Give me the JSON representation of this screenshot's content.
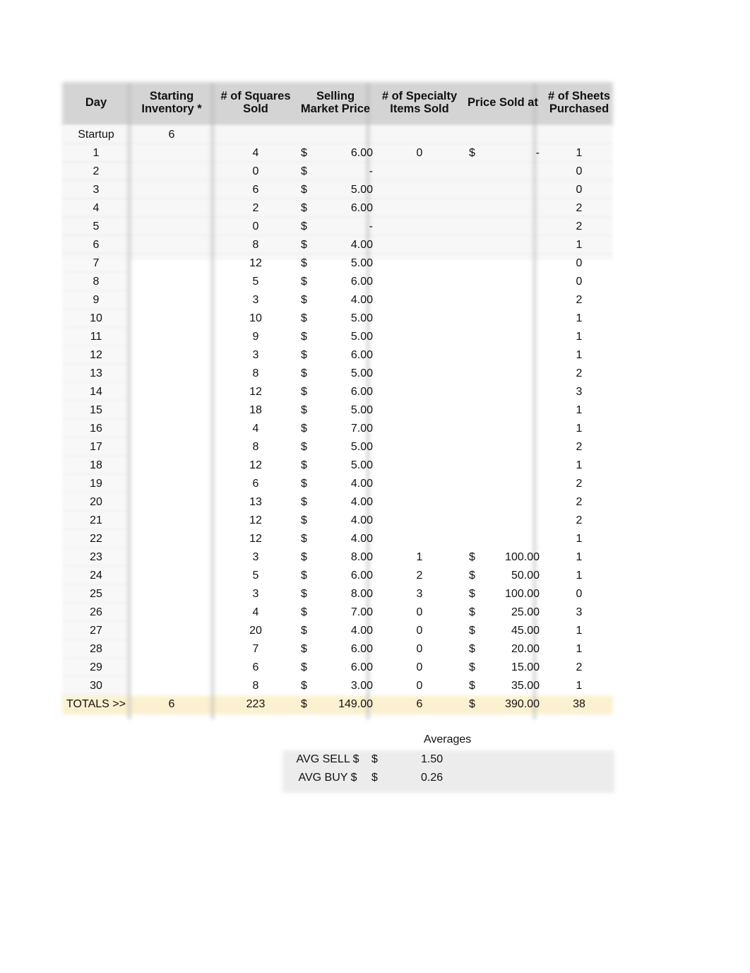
{
  "headers": {
    "day": "Day",
    "starting_inventory": [
      "Starting",
      "Inventory *"
    ],
    "squares_sold": [
      "# of Squares",
      "Sold"
    ],
    "selling_price": [
      "Selling",
      "Market  Price"
    ],
    "specialty_items": [
      "# of Specialty",
      "Items Sold"
    ],
    "price_sold_at": "Price Sold at",
    "sheets_purchased": [
      "# of Sheets",
      "Purchased"
    ]
  },
  "startup": {
    "label": "Startup",
    "inventory": "6"
  },
  "rows": [
    {
      "day": "1",
      "sq": "4",
      "cur": "$",
      "price": "6.00",
      "spec": "0",
      "cur2": "$",
      "sold": "-",
      "sheets": "1"
    },
    {
      "day": "2",
      "sq": "0",
      "cur": "$",
      "price": "-",
      "spec": "",
      "cur2": "",
      "sold": "",
      "sheets": "0"
    },
    {
      "day": "3",
      "sq": "6",
      "cur": "$",
      "price": "5.00",
      "spec": "",
      "cur2": "",
      "sold": "",
      "sheets": "0"
    },
    {
      "day": "4",
      "sq": "2",
      "cur": "$",
      "price": "6.00",
      "spec": "",
      "cur2": "",
      "sold": "",
      "sheets": "2"
    },
    {
      "day": "5",
      "sq": "0",
      "cur": "$",
      "price": "-",
      "spec": "",
      "cur2": "",
      "sold": "",
      "sheets": "2"
    },
    {
      "day": "6",
      "sq": "8",
      "cur": "$",
      "price": "4.00",
      "spec": "",
      "cur2": "",
      "sold": "",
      "sheets": "1"
    },
    {
      "day": "7",
      "sq": "12",
      "cur": "$",
      "price": "5.00",
      "spec": "",
      "cur2": "",
      "sold": "",
      "sheets": "0"
    },
    {
      "day": "8",
      "sq": "5",
      "cur": "$",
      "price": "6.00",
      "spec": "",
      "cur2": "",
      "sold": "",
      "sheets": "0"
    },
    {
      "day": "9",
      "sq": "3",
      "cur": "$",
      "price": "4.00",
      "spec": "",
      "cur2": "",
      "sold": "",
      "sheets": "2"
    },
    {
      "day": "10",
      "sq": "10",
      "cur": "$",
      "price": "5.00",
      "spec": "",
      "cur2": "",
      "sold": "",
      "sheets": "1"
    },
    {
      "day": "11",
      "sq": "9",
      "cur": "$",
      "price": "5.00",
      "spec": "",
      "cur2": "",
      "sold": "",
      "sheets": "1"
    },
    {
      "day": "12",
      "sq": "3",
      "cur": "$",
      "price": "6.00",
      "spec": "",
      "cur2": "",
      "sold": "",
      "sheets": "1"
    },
    {
      "day": "13",
      "sq": "8",
      "cur": "$",
      "price": "5.00",
      "spec": "",
      "cur2": "",
      "sold": "",
      "sheets": "2"
    },
    {
      "day": "14",
      "sq": "12",
      "cur": "$",
      "price": "6.00",
      "spec": "",
      "cur2": "",
      "sold": "",
      "sheets": "3"
    },
    {
      "day": "15",
      "sq": "18",
      "cur": "$",
      "price": "5.00",
      "spec": "",
      "cur2": "",
      "sold": "",
      "sheets": "1"
    },
    {
      "day": "16",
      "sq": "4",
      "cur": "$",
      "price": "7.00",
      "spec": "",
      "cur2": "",
      "sold": "",
      "sheets": "1"
    },
    {
      "day": "17",
      "sq": "8",
      "cur": "$",
      "price": "5.00",
      "spec": "",
      "cur2": "",
      "sold": "",
      "sheets": "2"
    },
    {
      "day": "18",
      "sq": "12",
      "cur": "$",
      "price": "5.00",
      "spec": "",
      "cur2": "",
      "sold": "",
      "sheets": "1"
    },
    {
      "day": "19",
      "sq": "6",
      "cur": "$",
      "price": "4.00",
      "spec": "",
      "cur2": "",
      "sold": "",
      "sheets": "2"
    },
    {
      "day": "20",
      "sq": "13",
      "cur": "$",
      "price": "4.00",
      "spec": "",
      "cur2": "",
      "sold": "",
      "sheets": "2"
    },
    {
      "day": "21",
      "sq": "12",
      "cur": "$",
      "price": "4.00",
      "spec": "",
      "cur2": "",
      "sold": "",
      "sheets": "2"
    },
    {
      "day": "22",
      "sq": "12",
      "cur": "$",
      "price": "4.00",
      "spec": "",
      "cur2": "",
      "sold": "",
      "sheets": "1"
    },
    {
      "day": "23",
      "sq": "3",
      "cur": "$",
      "price": "8.00",
      "spec": "1",
      "cur2": "$",
      "sold": "100.00",
      "sheets": "1"
    },
    {
      "day": "24",
      "sq": "5",
      "cur": "$",
      "price": "6.00",
      "spec": "2",
      "cur2": "$",
      "sold": "50.00",
      "sheets": "1"
    },
    {
      "day": "25",
      "sq": "3",
      "cur": "$",
      "price": "8.00",
      "spec": "3",
      "cur2": "$",
      "sold": "100.00",
      "sheets": "0"
    },
    {
      "day": "26",
      "sq": "4",
      "cur": "$",
      "price": "7.00",
      "spec": "0",
      "cur2": "$",
      "sold": "25.00",
      "sheets": "3"
    },
    {
      "day": "27",
      "sq": "20",
      "cur": "$",
      "price": "4.00",
      "spec": "0",
      "cur2": "$",
      "sold": "45.00",
      "sheets": "1"
    },
    {
      "day": "28",
      "sq": "7",
      "cur": "$",
      "price": "6.00",
      "spec": "0",
      "cur2": "$",
      "sold": "20.00",
      "sheets": "1"
    },
    {
      "day": "29",
      "sq": "6",
      "cur": "$",
      "price": "6.00",
      "spec": "0",
      "cur2": "$",
      "sold": "15.00",
      "sheets": "2"
    },
    {
      "day": "30",
      "sq": "8",
      "cur": "$",
      "price": "3.00",
      "spec": "0",
      "cur2": "$",
      "sold": "35.00",
      "sheets": "1"
    }
  ],
  "totals": {
    "label": "TOTALS >>",
    "inventory": "6",
    "sq": "223",
    "cur": "$",
    "price": "149.00",
    "spec": "6",
    "cur2": "$",
    "sold": "390.00",
    "sheets": "38"
  },
  "averages": {
    "title": "Averages",
    "rows": [
      {
        "label": "AVG SELL $",
        "cur": "$",
        "value": "1.50"
      },
      {
        "label": "AVG BUY $",
        "cur": "$",
        "value": "0.26"
      }
    ]
  },
  "colors": {
    "header_band": "#d4d4d4",
    "totals_band": "#fbf0cf"
  }
}
